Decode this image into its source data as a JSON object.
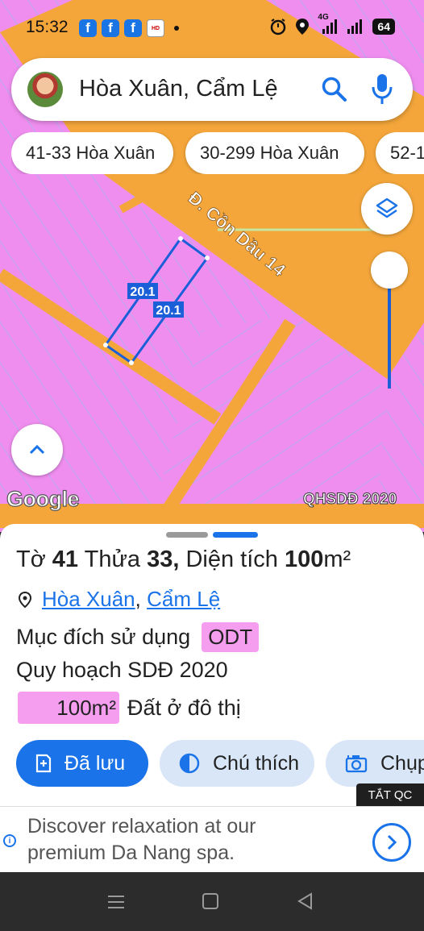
{
  "status_bar": {
    "time": "15:32",
    "notification_icons": [
      "facebook-icon",
      "facebook-icon",
      "facebook-icon",
      "hd-app-icon"
    ],
    "network_label": "4G",
    "battery": "64"
  },
  "search": {
    "query": "Hòa Xuân, Cẩm Lệ"
  },
  "chips": [
    {
      "label": "41-33 Hòa Xuân"
    },
    {
      "label": "30-299 Hòa Xuân"
    },
    {
      "label": "52-1"
    }
  ],
  "map": {
    "street_label": "Đ. Cồn Dầu 14",
    "edge_label_1": "20.1",
    "edge_label_2": "20.1",
    "attribution": "Google",
    "layer_label": "QHSDĐ 2020",
    "colors": {
      "residential": "#f08ef0",
      "road": "#f4a63a",
      "selection": "#1a5fd8"
    }
  },
  "sheet": {
    "title_prefix": "Tờ",
    "sheet_no": "41",
    "parcel_word": "Thửa",
    "parcel_no": "33,",
    "area_word": "Diện tích",
    "area_value": "100",
    "area_unit": "m²",
    "ward": "Hòa Xuân",
    "district": "Cẩm Lệ",
    "usage_label": "Mục đích sử dụng",
    "usage_code": "ODT",
    "plan_label": "Quy hoạch SDĐ 2020",
    "plan_area": "100m²",
    "plan_desc": "Đất ở đô thị"
  },
  "actions": [
    {
      "label": "Đã lưu",
      "icon": "bookmark-add-icon"
    },
    {
      "label": "Chú thích",
      "icon": "contrast-icon"
    },
    {
      "label": "Chụp",
      "icon": "camera-icon"
    }
  ],
  "ad": {
    "close_label": "TẮT QC",
    "line1": "Discover relaxation at our",
    "line2": "premium Da Nang spa."
  }
}
